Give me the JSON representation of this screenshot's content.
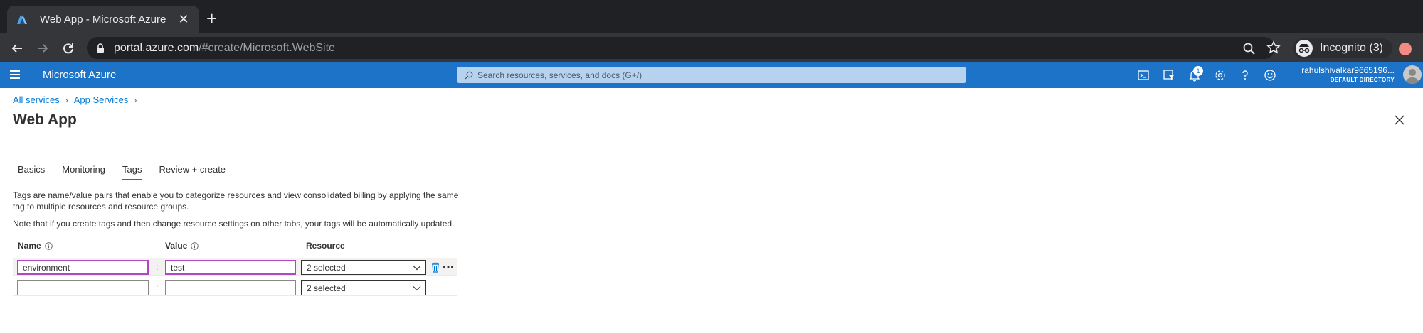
{
  "browser": {
    "tab_title": "Web App - Microsoft Azure",
    "url_host": "portal.azure.com",
    "url_path": "/#create/Microsoft.WebSite",
    "incognito_label": "Incognito (3)"
  },
  "header": {
    "brand": "Microsoft Azure",
    "search_placeholder": "Search resources, services, and docs (G+/)",
    "notification_count": "1",
    "account_name": "rahulshivalkar9665196...",
    "account_directory": "DEFAULT DIRECTORY"
  },
  "breadcrumb": [
    "All services",
    "App Services"
  ],
  "page": {
    "title": "Web App",
    "tabs": [
      "Basics",
      "Monitoring",
      "Tags",
      "Review + create"
    ],
    "active_tab": "Tags",
    "description_1": "Tags are name/value pairs that enable you to categorize resources and view consolidated billing by applying the same tag to multiple resources and resource groups.",
    "description_2": "Note that if you create tags and then change resource settings on other tabs, your tags will be automatically updated."
  },
  "tags_table": {
    "headers": {
      "name": "Name",
      "value": "Value",
      "resource": "Resource"
    },
    "separator": ":",
    "rows": [
      {
        "name": "environment",
        "value": "test",
        "resource": "2 selected"
      },
      {
        "name": "",
        "value": "",
        "resource": "2 selected"
      }
    ]
  },
  "colors": {
    "azure_header": "#1c73c8",
    "link": "#0078d4",
    "input_hover": "#b146c2"
  }
}
